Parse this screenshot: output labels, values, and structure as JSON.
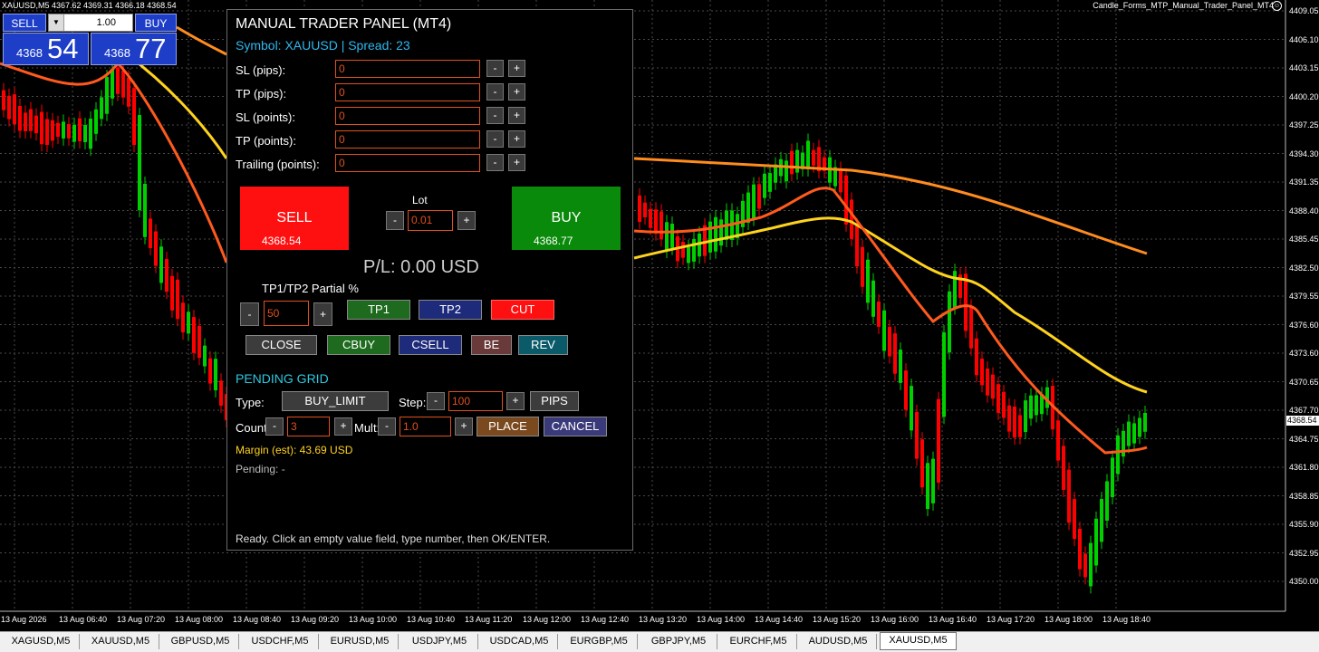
{
  "header": {
    "symbol_info": "XAUUSD,M5  4367.62 4369.31 4366.18 4368.54",
    "indicator": "Candle_Forms_MTP_Manual_Trader_Panel_MT4"
  },
  "one_click": {
    "sell_label": "SELL",
    "buy_label": "BUY",
    "lot": "1.00",
    "sell_small": "4368",
    "sell_big": "54",
    "buy_small": "4368",
    "buy_big": "77"
  },
  "panel": {
    "title": "MANUAL TRADER PANEL (MT4)",
    "symbol_line": "Symbol: XAUUSD | Spread: 23",
    "rows": [
      {
        "label": "SL (pips):",
        "value": "0"
      },
      {
        "label": "TP (pips):",
        "value": "0"
      },
      {
        "label": "SL (points):",
        "value": "0"
      },
      {
        "label": "TP (points):",
        "value": "0"
      },
      {
        "label": "Trailing (points):",
        "value": "0"
      }
    ],
    "minus": "-",
    "plus": "+",
    "sell_label": "SELL",
    "sell_price": "4368.54",
    "buy_label": "BUY",
    "buy_price": "4368.77",
    "lot_label": "Lot",
    "lot_value": "0.01",
    "pl": "P/L: 0.00 USD",
    "partial_label": "TP1/TP2 Partial %",
    "partial_value": "50",
    "tp1": "TP1",
    "tp2": "TP2",
    "cut": "CUT",
    "close": "CLOSE",
    "cbuy": "CBUY",
    "csell": "CSELL",
    "be": "BE",
    "rev": "REV",
    "pending_title": "PENDING GRID",
    "type_label": "Type:",
    "type_value": "BUY_LIMIT",
    "step_label": "Step:",
    "step_value": "100",
    "pips": "PIPS",
    "count_label": "Count:",
    "count_value": "3",
    "mult_label": "Mult:",
    "mult_value": "1.0",
    "place": "PLACE",
    "cancel": "CANCEL",
    "margin": "Margin (est): 43.69 USD",
    "pending": "Pending: -",
    "status": "Ready. Click an empty value field, type number, then OK/ENTER."
  },
  "axis": {
    "price_labels": [
      "4409.05",
      "4406.10",
      "4403.15",
      "4400.20",
      "4397.25",
      "4394.30",
      "4391.35",
      "4388.40",
      "4385.45",
      "4382.50",
      "4379.55",
      "4376.60",
      "4373.60",
      "4370.65",
      "4367.70",
      "4364.75",
      "4361.80",
      "4358.85",
      "4355.90",
      "4352.95",
      "4350.00"
    ],
    "current_price": "4368.54",
    "time_labels": [
      "13 Aug 2026",
      "13 Aug 06:40",
      "13 Aug 07:20",
      "13 Aug 08:00",
      "13 Aug 08:40",
      "13 Aug 09:20",
      "13 Aug 10:00",
      "13 Aug 10:40",
      "13 Aug 11:20",
      "13 Aug 12:00",
      "13 Aug 12:40",
      "13 Aug 13:20",
      "13 Aug 14:00",
      "13 Aug 14:40",
      "13 Aug 15:20",
      "13 Aug 16:00",
      "13 Aug 16:40",
      "13 Aug 17:20",
      "13 Aug 18:00",
      "13 Aug 18:40"
    ]
  },
  "tabs": [
    "XAGUSD,M5",
    "XAUUSD,M5",
    "GBPUSD,M5",
    "USDCHF,M5",
    "EURUSD,M5",
    "USDJPY,M5",
    "USDCAD,M5",
    "EURGBP,M5",
    "GBPJPY,M5",
    "EURCHF,M5",
    "AUDUSD,M5",
    "XAUUSD,M5"
  ],
  "active_tab_index": 11,
  "colors": {
    "bull": "#00d000",
    "bear": "#ff0000",
    "ma_fast": "#ff5a1e",
    "ma_mid": "#ffd21e",
    "ma_slow": "#ff8c1e",
    "grid": "#4a4a4a"
  }
}
